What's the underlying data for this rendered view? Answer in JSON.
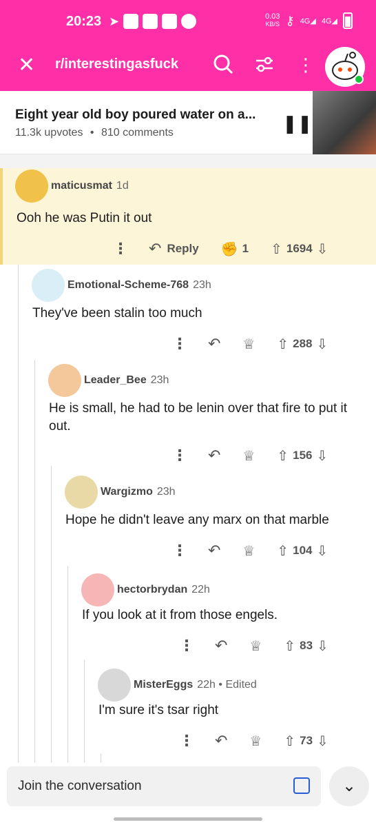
{
  "status": {
    "time": "20:23",
    "net_speed": "0.03",
    "net_unit": "KB/S",
    "net_4g_a": "4G",
    "net_4g_b": "4G"
  },
  "nav": {
    "close_icon": "close-icon",
    "subreddit": "r/interestingasfuck",
    "search_icon": "search-icon",
    "filter_icon": "filter-icon",
    "more_icon": "more-icon"
  },
  "post": {
    "title": "Eight year old boy poured water on a...",
    "upvotes": "11.3k upvotes",
    "separator": "•",
    "comments": "810 comments",
    "pause_icon": "pause-icon"
  },
  "comments": [
    {
      "user": "maticusmat",
      "time": "1d",
      "body": "Ooh he was Putin it out",
      "reply": "Reply",
      "award_count": "1",
      "score": "1694"
    },
    {
      "user": "Emotional-Scheme-768",
      "time": "23h",
      "body": "They've been stalin too much",
      "score": "288"
    },
    {
      "user": "Leader_Bee",
      "time": "23h",
      "body": "He is small, he had to be lenin over that fire to put it out.",
      "score": "156"
    },
    {
      "user": "Wargizmo",
      "time": "23h",
      "body": "Hope he didn't leave any marx on that marble",
      "score": "104"
    },
    {
      "user": "hectorbrydan",
      "time": "22h",
      "body": "If you look at it from those engels.",
      "score": "83"
    },
    {
      "user": "MisterEggs",
      "time": "22h • Edited",
      "body": "I'm sure it's tsar right",
      "score": "73"
    }
  ],
  "composer": {
    "placeholder": "Join the conversation",
    "image_icon": "image-icon",
    "collapse_icon": "chevron-down-icon"
  },
  "colors": {
    "brand": "#ff2fa8",
    "highlight_bg": "#fdf5d7"
  }
}
